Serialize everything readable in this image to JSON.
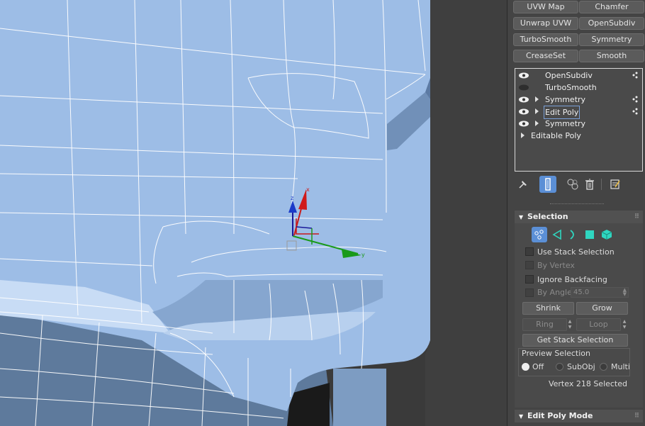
{
  "modifier_buttons": [
    "UVW Map",
    "Chamfer",
    "Unwrap UVW",
    "OpenSubdiv",
    "TurboSmooth",
    "Symmetry",
    "CreaseSet",
    "Smooth"
  ],
  "stack": [
    {
      "label": "OpenSubdiv",
      "eye": "on",
      "expander": false,
      "dots": true
    },
    {
      "label": "TurboSmooth",
      "eye": "off",
      "expander": false,
      "dots": false
    },
    {
      "label": "Symmetry",
      "eye": "on",
      "expander": true,
      "dots": true
    },
    {
      "label": "Edit Poly",
      "eye": "on",
      "expander": true,
      "dots": true,
      "selected": true
    },
    {
      "label": "Symmetry",
      "eye": "on",
      "expander": true,
      "dots": false
    },
    {
      "label": "Editable Poly",
      "eye": "none",
      "expander": true,
      "dots": false
    }
  ],
  "toolbar_icons": [
    "pin-stack-icon",
    "show-end-result-icon",
    "make-unique-icon",
    "remove-modifier-icon",
    "configure-modifier-sets-icon"
  ],
  "selection": {
    "title": "Selection",
    "subobject_icons": [
      "vertex-icon",
      "edge-icon",
      "border-icon",
      "polygon-icon",
      "element-icon"
    ],
    "use_stack_selection": "Use Stack Selection",
    "by_vertex": "By Vertex",
    "ignore_backfacing": "Ignore Backfacing",
    "by_angle": "By Angle:",
    "angle_value": "45.0",
    "shrink": "Shrink",
    "grow": "Grow",
    "ring": "Ring",
    "loop": "Loop",
    "get_stack_selection": "Get Stack Selection",
    "preview_selection": "Preview Selection",
    "preview_options": [
      "Off",
      "SubObj",
      "Multi"
    ],
    "preview_selected": "Off",
    "status": "Vertex 218 Selected"
  },
  "edit_poly_mode": {
    "title": "Edit Poly Mode"
  },
  "gizmo": {
    "axes": [
      "x",
      "y",
      "z"
    ]
  },
  "colors": {
    "mesh": "#9dbde6",
    "wire": "#ffffff",
    "panel": "#444444",
    "accent": "#5b8fd6"
  }
}
